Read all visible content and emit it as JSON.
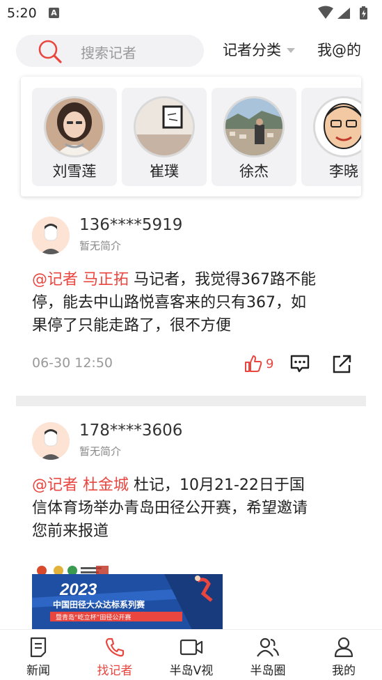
{
  "status_bar": {
    "time": "5:20",
    "notification_glyph": "A"
  },
  "search": {
    "placeholder": "搜索记者"
  },
  "header": {
    "category_label": "记者分类",
    "my_at_label": "我@的"
  },
  "reporters": [
    {
      "name": "刘雪莲"
    },
    {
      "name": "崔璞"
    },
    {
      "name": "徐杰"
    },
    {
      "name": "李晓"
    }
  ],
  "posts": [
    {
      "user": "136****5919",
      "bio": "暂无简介",
      "mention": "@记者 马正拓",
      "line1_rest": " 马记者，我觉得367路不能",
      "line2": "停，能去中山路悦喜客来的只有367，如",
      "line3": "果停了只能走路了，很不方便",
      "time": "06-30 12:50",
      "likes": "9"
    },
    {
      "user": "178****3606",
      "bio": "暂无简介",
      "mention": "@记者 杜金城",
      "line1_rest": " 杜记，10月21-22日于国",
      "line2": "信体育场举办青岛田径公开赛，希望邀请",
      "line3": "您前来报道",
      "image": {
        "year": "2023",
        "title": "中国田径大众达标系列赛",
        "subtitle": "暨青岛“屹立杯”田径公开赛"
      }
    }
  ],
  "nav": {
    "items": [
      {
        "label": "新闻",
        "icon": "news-icon"
      },
      {
        "label": "找记者",
        "icon": "phone-icon"
      },
      {
        "label": "半岛V视",
        "icon": "video-icon"
      },
      {
        "label": "半岛圈",
        "icon": "people-icon"
      },
      {
        "label": "我的",
        "icon": "person-icon"
      }
    ],
    "active_index": 1
  },
  "colors": {
    "accent": "#e8463f",
    "banner_blue": "#1e4fa3"
  }
}
